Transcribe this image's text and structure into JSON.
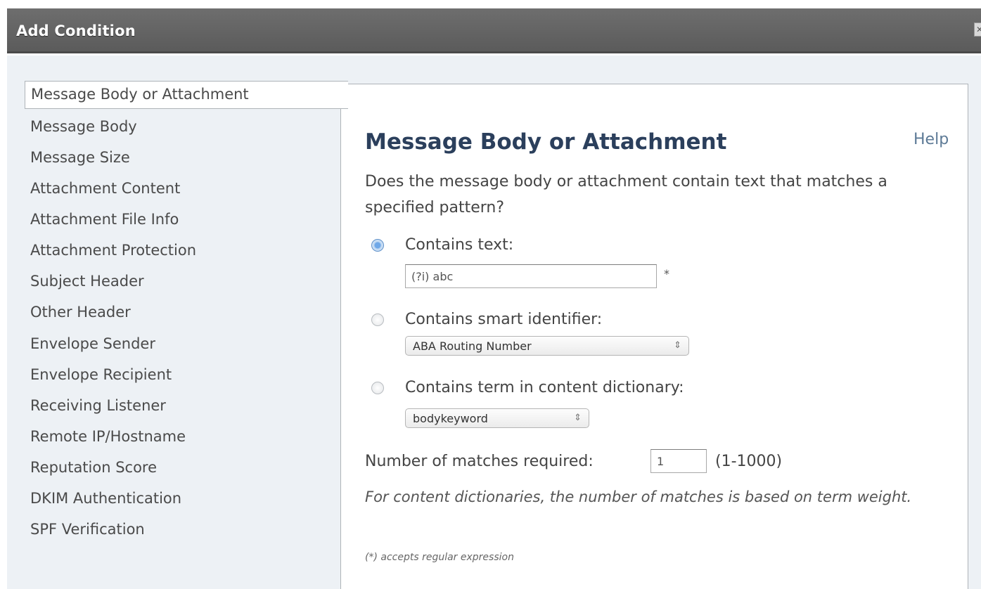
{
  "titlebar": {
    "title": "Add Condition",
    "close_glyph": "✕"
  },
  "nav": {
    "items": [
      {
        "label": "Message Body or Attachment",
        "selected": true
      },
      {
        "label": "Message Body"
      },
      {
        "label": "Message Size"
      },
      {
        "label": "Attachment Content"
      },
      {
        "label": "Attachment File Info"
      },
      {
        "label": "Attachment Protection"
      },
      {
        "label": "Subject Header"
      },
      {
        "label": "Other Header"
      },
      {
        "label": "Envelope Sender"
      },
      {
        "label": "Envelope Recipient"
      },
      {
        "label": "Receiving Listener"
      },
      {
        "label": "Remote IP/Hostname"
      },
      {
        "label": "Reputation Score"
      },
      {
        "label": "DKIM Authentication"
      },
      {
        "label": "SPF Verification"
      }
    ]
  },
  "panel": {
    "title": "Message Body or Attachment",
    "help": "Help",
    "description": "Does the message body or attachment contain text that matches a specified pattern?",
    "options": {
      "contains_text": {
        "label": "Contains text:",
        "selected": true,
        "value": "(?i) abc",
        "required_mark": "*"
      },
      "smart_identifier": {
        "label": "Contains smart identifier:",
        "selected": false,
        "value": "ABA Routing Number"
      },
      "dictionary": {
        "label": "Contains term in content dictionary:",
        "selected": false,
        "value": "bodykeyword"
      }
    },
    "matches": {
      "label": "Number of matches required:",
      "value": "1",
      "range": "(1-1000)"
    },
    "note": "For content dictionaries, the number of matches is based on term weight.",
    "footnote": "(*) accepts regular expression",
    "select_caret": "⇕"
  },
  "colors": {
    "titlebar": "#5f5f5f",
    "body_bg": "#edf1f5",
    "heading": "#2b3f5c",
    "link": "#5d7a96"
  }
}
